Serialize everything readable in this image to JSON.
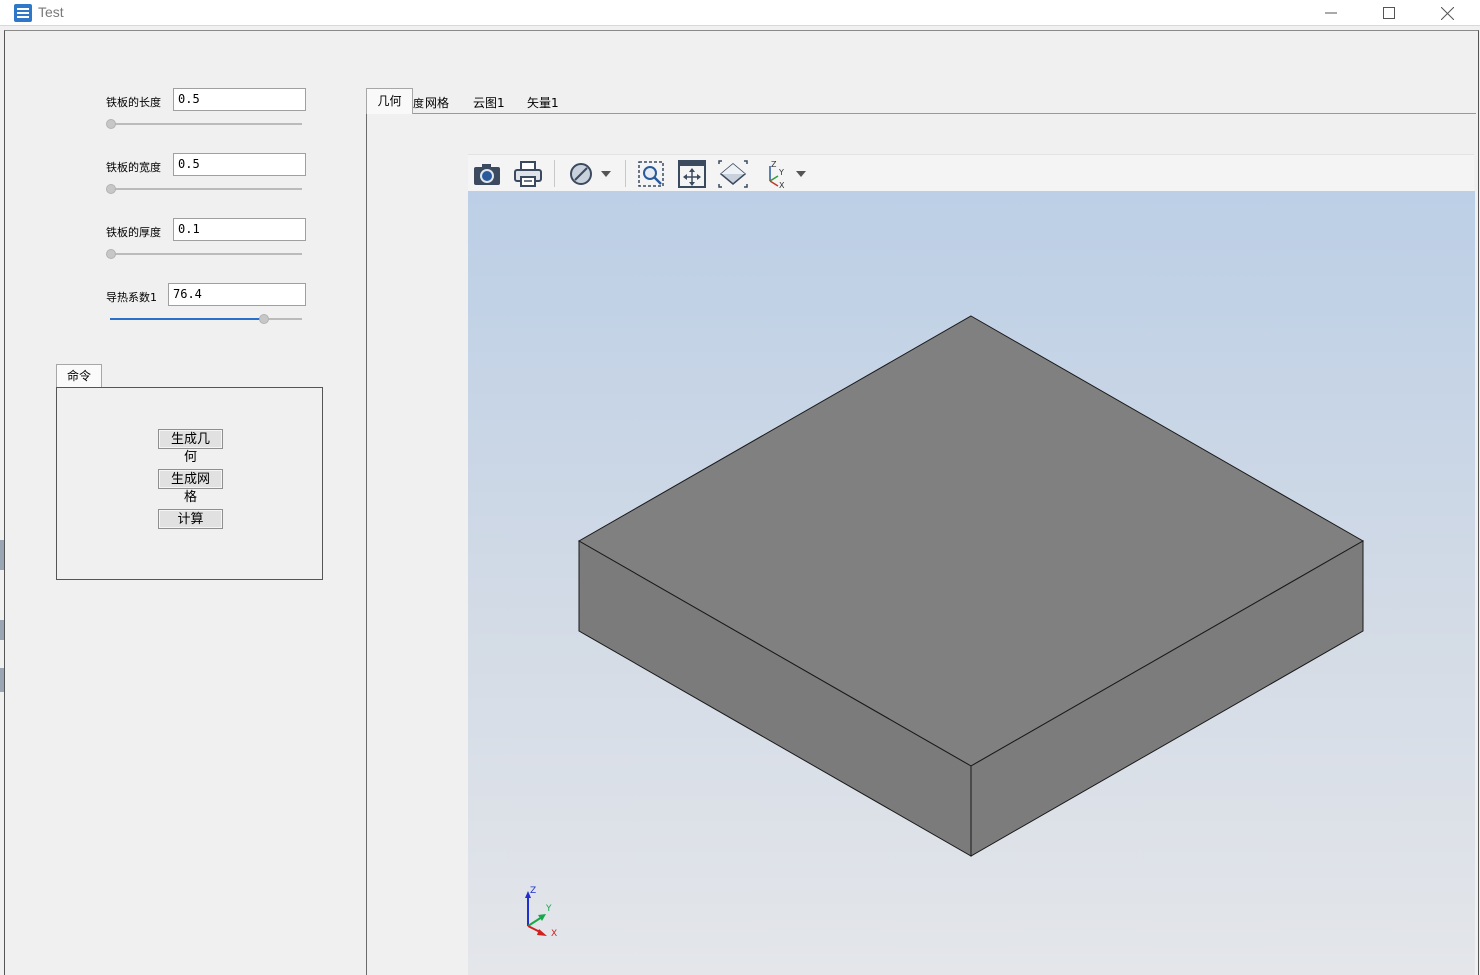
{
  "window": {
    "title": "Test",
    "minimize_glyph": "—",
    "maximize_glyph": "☐",
    "close_glyph": "✕"
  },
  "params": [
    {
      "label": "铁板的长度",
      "value": "0.5",
      "slider_fraction": 0.0
    },
    {
      "label": "铁板的宽度",
      "value": "0.5",
      "slider_fraction": 0.0
    },
    {
      "label": "铁板的厚度",
      "value": "0.1",
      "slider_fraction": 0.0
    },
    {
      "label": "导热系数1",
      "value": "76.4",
      "slider_fraction": 0.8
    }
  ],
  "command": {
    "tab_label": "命令",
    "buttons": [
      "生成几何",
      "生成网格",
      "计算"
    ]
  },
  "view_tabs": {
    "active": "几何",
    "overlap_char": "度",
    "items": [
      "网格",
      "云图1",
      "矢量1"
    ]
  },
  "toolbar": {
    "icons": [
      "camera-icon",
      "print-icon",
      "display-mode-icon",
      "dropdown-arrow-icon",
      "zoom-window-icon",
      "fit-all-icon",
      "iso-view-icon",
      "axis-view-icon",
      "dropdown-arrow-icon"
    ]
  },
  "axis_triad": {
    "x": "X",
    "y": "Y",
    "z": "Z"
  },
  "colors": {
    "accent": "#2a6fcc",
    "box_face": "#808080",
    "viewport_top": "#bccfe6",
    "viewport_bottom": "#e4e6ea"
  }
}
